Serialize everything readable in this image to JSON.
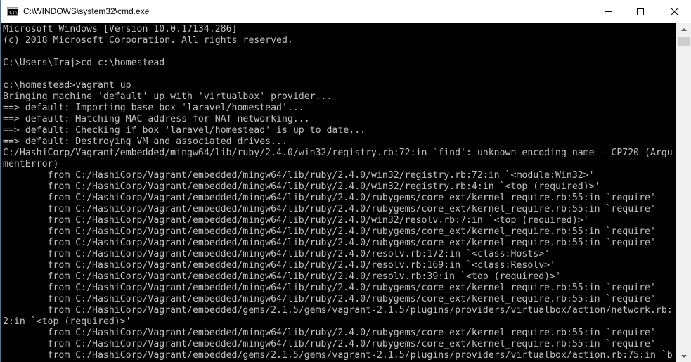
{
  "window": {
    "title": "C:\\WINDOWS\\system32\\cmd.exe",
    "app_icon_glyph": "C:\\"
  },
  "console": {
    "lines": [
      "Microsoft Windows [Version 10.0.17134.286]",
      "(c) 2018 Microsoft Corporation. All rights reserved.",
      "",
      "C:\\Users\\Iraj>cd c:\\homestead",
      "",
      "c:\\homestead>vagrant up",
      "Bringing machine 'default' up with 'virtualbox' provider...",
      "==> default: Importing base box 'laravel/homestead'...",
      "==> default: Matching MAC address for NAT networking...",
      "==> default: Checking if box 'laravel/homestead' is up to date...",
      "==> default: Destroying VM and associated drives...",
      "C:/HashiCorp/Vagrant/embedded/mingw64/lib/ruby/2.4.0/win32/registry.rb:72:in `find': unknown encoding name - CP720 (Argu",
      "mentError)",
      "        from C:/HashiCorp/Vagrant/embedded/mingw64/lib/ruby/2.4.0/win32/registry.rb:72:in `<module:Win32>'",
      "        from C:/HashiCorp/Vagrant/embedded/mingw64/lib/ruby/2.4.0/win32/registry.rb:4:in `<top (required)>'",
      "        from C:/HashiCorp/Vagrant/embedded/mingw64/lib/ruby/2.4.0/rubygems/core_ext/kernel_require.rb:55:in `require'",
      "        from C:/HashiCorp/Vagrant/embedded/mingw64/lib/ruby/2.4.0/rubygems/core_ext/kernel_require.rb:55:in `require'",
      "        from C:/HashiCorp/Vagrant/embedded/mingw64/lib/ruby/2.4.0/win32/resolv.rb:7:in `<top (required)>'",
      "        from C:/HashiCorp/Vagrant/embedded/mingw64/lib/ruby/2.4.0/rubygems/core_ext/kernel_require.rb:55:in `require'",
      "        from C:/HashiCorp/Vagrant/embedded/mingw64/lib/ruby/2.4.0/rubygems/core_ext/kernel_require.rb:55:in `require'",
      "        from C:/HashiCorp/Vagrant/embedded/mingw64/lib/ruby/2.4.0/resolv.rb:172:in `<class:Hosts>'",
      "        from C:/HashiCorp/Vagrant/embedded/mingw64/lib/ruby/2.4.0/resolv.rb:169:in `<class:Resolv>'",
      "        from C:/HashiCorp/Vagrant/embedded/mingw64/lib/ruby/2.4.0/resolv.rb:39:in `<top (required)>'",
      "        from C:/HashiCorp/Vagrant/embedded/mingw64/lib/ruby/2.4.0/rubygems/core_ext/kernel_require.rb:55:in `require'",
      "        from C:/HashiCorp/Vagrant/embedded/mingw64/lib/ruby/2.4.0/rubygems/core_ext/kernel_require.rb:55:in `require'",
      "        from C:/HashiCorp/Vagrant/embedded/gems/2.1.5/gems/vagrant-2.1.5/plugins/providers/virtualbox/action/network.rb:",
      "2:in `<top (required)>'",
      "        from C:/HashiCorp/Vagrant/embedded/mingw64/lib/ruby/2.4.0/rubygems/core_ext/kernel_require.rb:55:in `require'",
      "        from C:/HashiCorp/Vagrant/embedded/mingw64/lib/ruby/2.4.0/rubygems/core_ext/kernel_require.rb:55:in `require'",
      "        from C:/HashiCorp/Vagrant/embedded/gems/2.1.5/gems/vagrant-2.1.5/plugins/providers/virtualbox/action.rb:75:in `b"
    ]
  },
  "colors": {
    "console_text": "#c0c0c0",
    "console_background": "#000000",
    "window_border": "#3c7fb1"
  }
}
